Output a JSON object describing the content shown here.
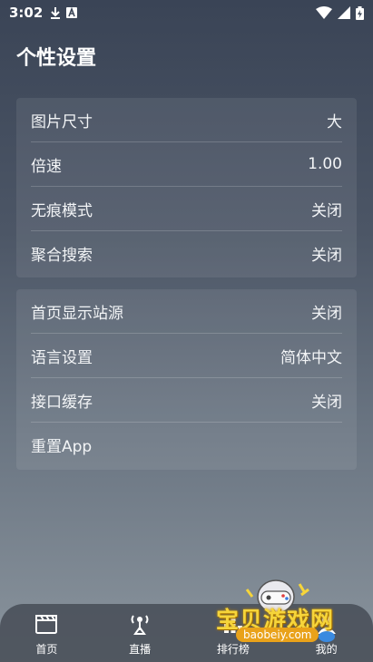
{
  "status_bar": {
    "time": "3:02",
    "icons_left": [
      "download-icon",
      "font-icon"
    ],
    "icons_right": [
      "wifi-icon",
      "signal-icon",
      "battery-icon"
    ]
  },
  "page": {
    "title": "个性设置"
  },
  "settings_group_1": [
    {
      "label": "图片尺寸",
      "value": "大"
    },
    {
      "label": "倍速",
      "value": "1.00"
    },
    {
      "label": "无痕模式",
      "value": "关闭"
    },
    {
      "label": "聚合搜索",
      "value": "关闭"
    }
  ],
  "settings_group_2": [
    {
      "label": "首页显示站源",
      "value": "关闭"
    },
    {
      "label": "语言设置",
      "value": "简体中文"
    },
    {
      "label": "接口缓存",
      "value": "关闭"
    },
    {
      "label": "重置App",
      "value": ""
    }
  ],
  "bottom_nav": [
    {
      "label": "首页",
      "icon": "clapperboard-icon"
    },
    {
      "label": "直播",
      "icon": "broadcast-icon"
    },
    {
      "label": "排行榜",
      "icon": "ranking-icon"
    },
    {
      "label": "我的",
      "icon": "profile-icon"
    }
  ],
  "watermark": {
    "text": "宝贝游戏网",
    "url": "baobeiy.com"
  }
}
